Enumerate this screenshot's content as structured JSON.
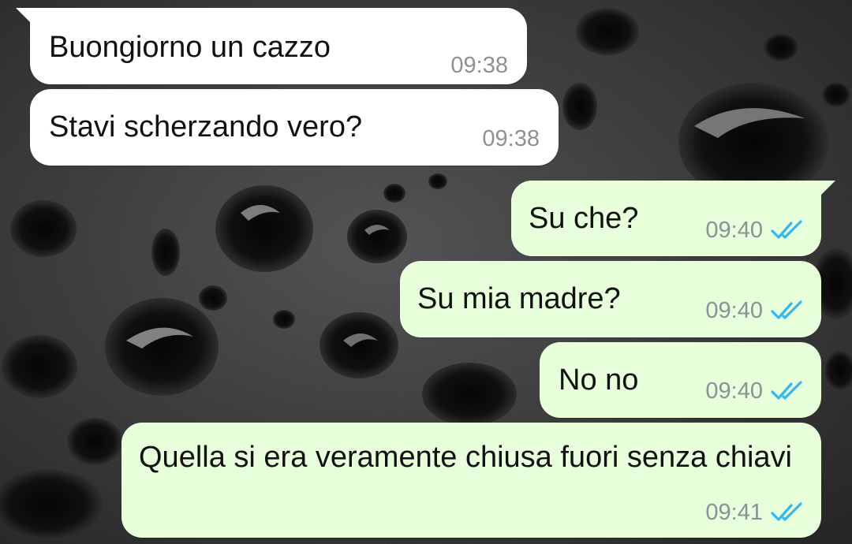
{
  "colors": {
    "incoming_bubble": "#ffffff",
    "outgoing_bubble": "#e7ffdb",
    "timestamp": "#8c9196",
    "read_ticks": "#34b7f1"
  },
  "wallpaper": {
    "icon": "water-drops-wallpaper"
  },
  "messages": [
    {
      "direction": "incoming",
      "text": "Buongiorno un cazzo",
      "time": "09:38"
    },
    {
      "direction": "incoming",
      "text": "Stavi scherzando vero?",
      "time": "09:38"
    },
    {
      "direction": "outgoing",
      "text": "Su che?",
      "time": "09:40",
      "status_icon": "double-check-read-icon"
    },
    {
      "direction": "outgoing",
      "text": "Su mia madre?",
      "time": "09:40",
      "status_icon": "double-check-read-icon"
    },
    {
      "direction": "outgoing",
      "text": "No no",
      "time": "09:40",
      "status_icon": "double-check-read-icon"
    },
    {
      "direction": "outgoing",
      "text": "Quella si era veramente chiusa fuori senza chiavi",
      "time": "09:41",
      "status_icon": "double-check-read-icon"
    }
  ]
}
